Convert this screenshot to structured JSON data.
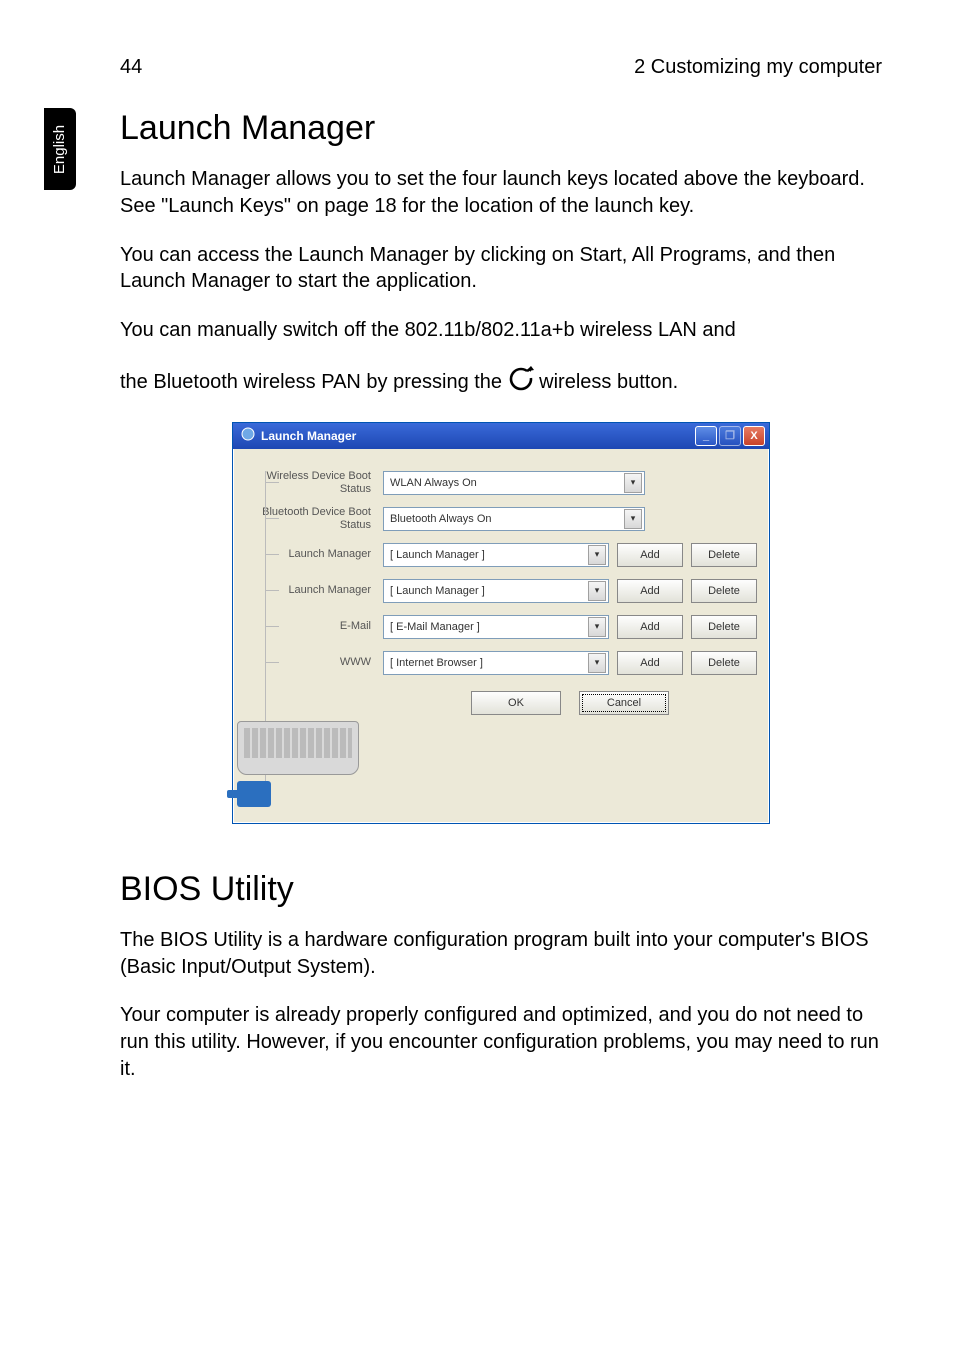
{
  "sidetab": "English",
  "header": {
    "page_num": "44",
    "chapter": "2 Customizing my computer"
  },
  "sections": {
    "launch_title": "Launch Manager",
    "launch_p1": "Launch Manager allows you to set the four launch keys located above the keyboard.  See \"Launch Keys\" on page 18 for the location of the launch key.",
    "launch_p2": "You can access the Launch Manager by clicking on Start, All Programs, and then Launch Manager to start the application.",
    "launch_p3a": "You can manually switch off the 802.11b/802.11a+b wireless LAN and",
    "launch_p3b_prefix": "the Bluetooth wireless PAN by pressing the  ",
    "launch_p3b_suffix": "  wireless button.",
    "bios_title": "BIOS Utility",
    "bios_p1": "The BIOS Utility is a hardware configuration program built into your computer's BIOS (Basic Input/Output System).",
    "bios_p2": "Your computer is already properly configured and optimized, and you do not need to run this utility.  However, if you encounter configuration problems, you may need to run it."
  },
  "dialog": {
    "title": "Launch Manager",
    "rows": [
      {
        "label": "Wireless Device Boot Status",
        "value": "WLAN Always On",
        "add": false,
        "del": false
      },
      {
        "label": "Bluetooth Device Boot Status",
        "value": "Bluetooth Always On",
        "add": false,
        "del": false
      },
      {
        "label": "Launch Manager",
        "value": "[  Launch Manager  ]",
        "add": true,
        "del": true
      },
      {
        "label": "Launch Manager",
        "value": "[  Launch Manager  ]",
        "add": true,
        "del": true
      },
      {
        "label": "E-Mail",
        "value": "[  E-Mail Manager  ]",
        "add": true,
        "del": true
      },
      {
        "label": "WWW",
        "value": "[  Internet Browser  ]",
        "add": true,
        "del": true
      }
    ],
    "btn_add": "Add",
    "btn_delete": "Delete",
    "btn_ok": "OK",
    "btn_cancel": "Cancel",
    "win_min": "_",
    "win_max": "❐",
    "win_close": "X"
  }
}
